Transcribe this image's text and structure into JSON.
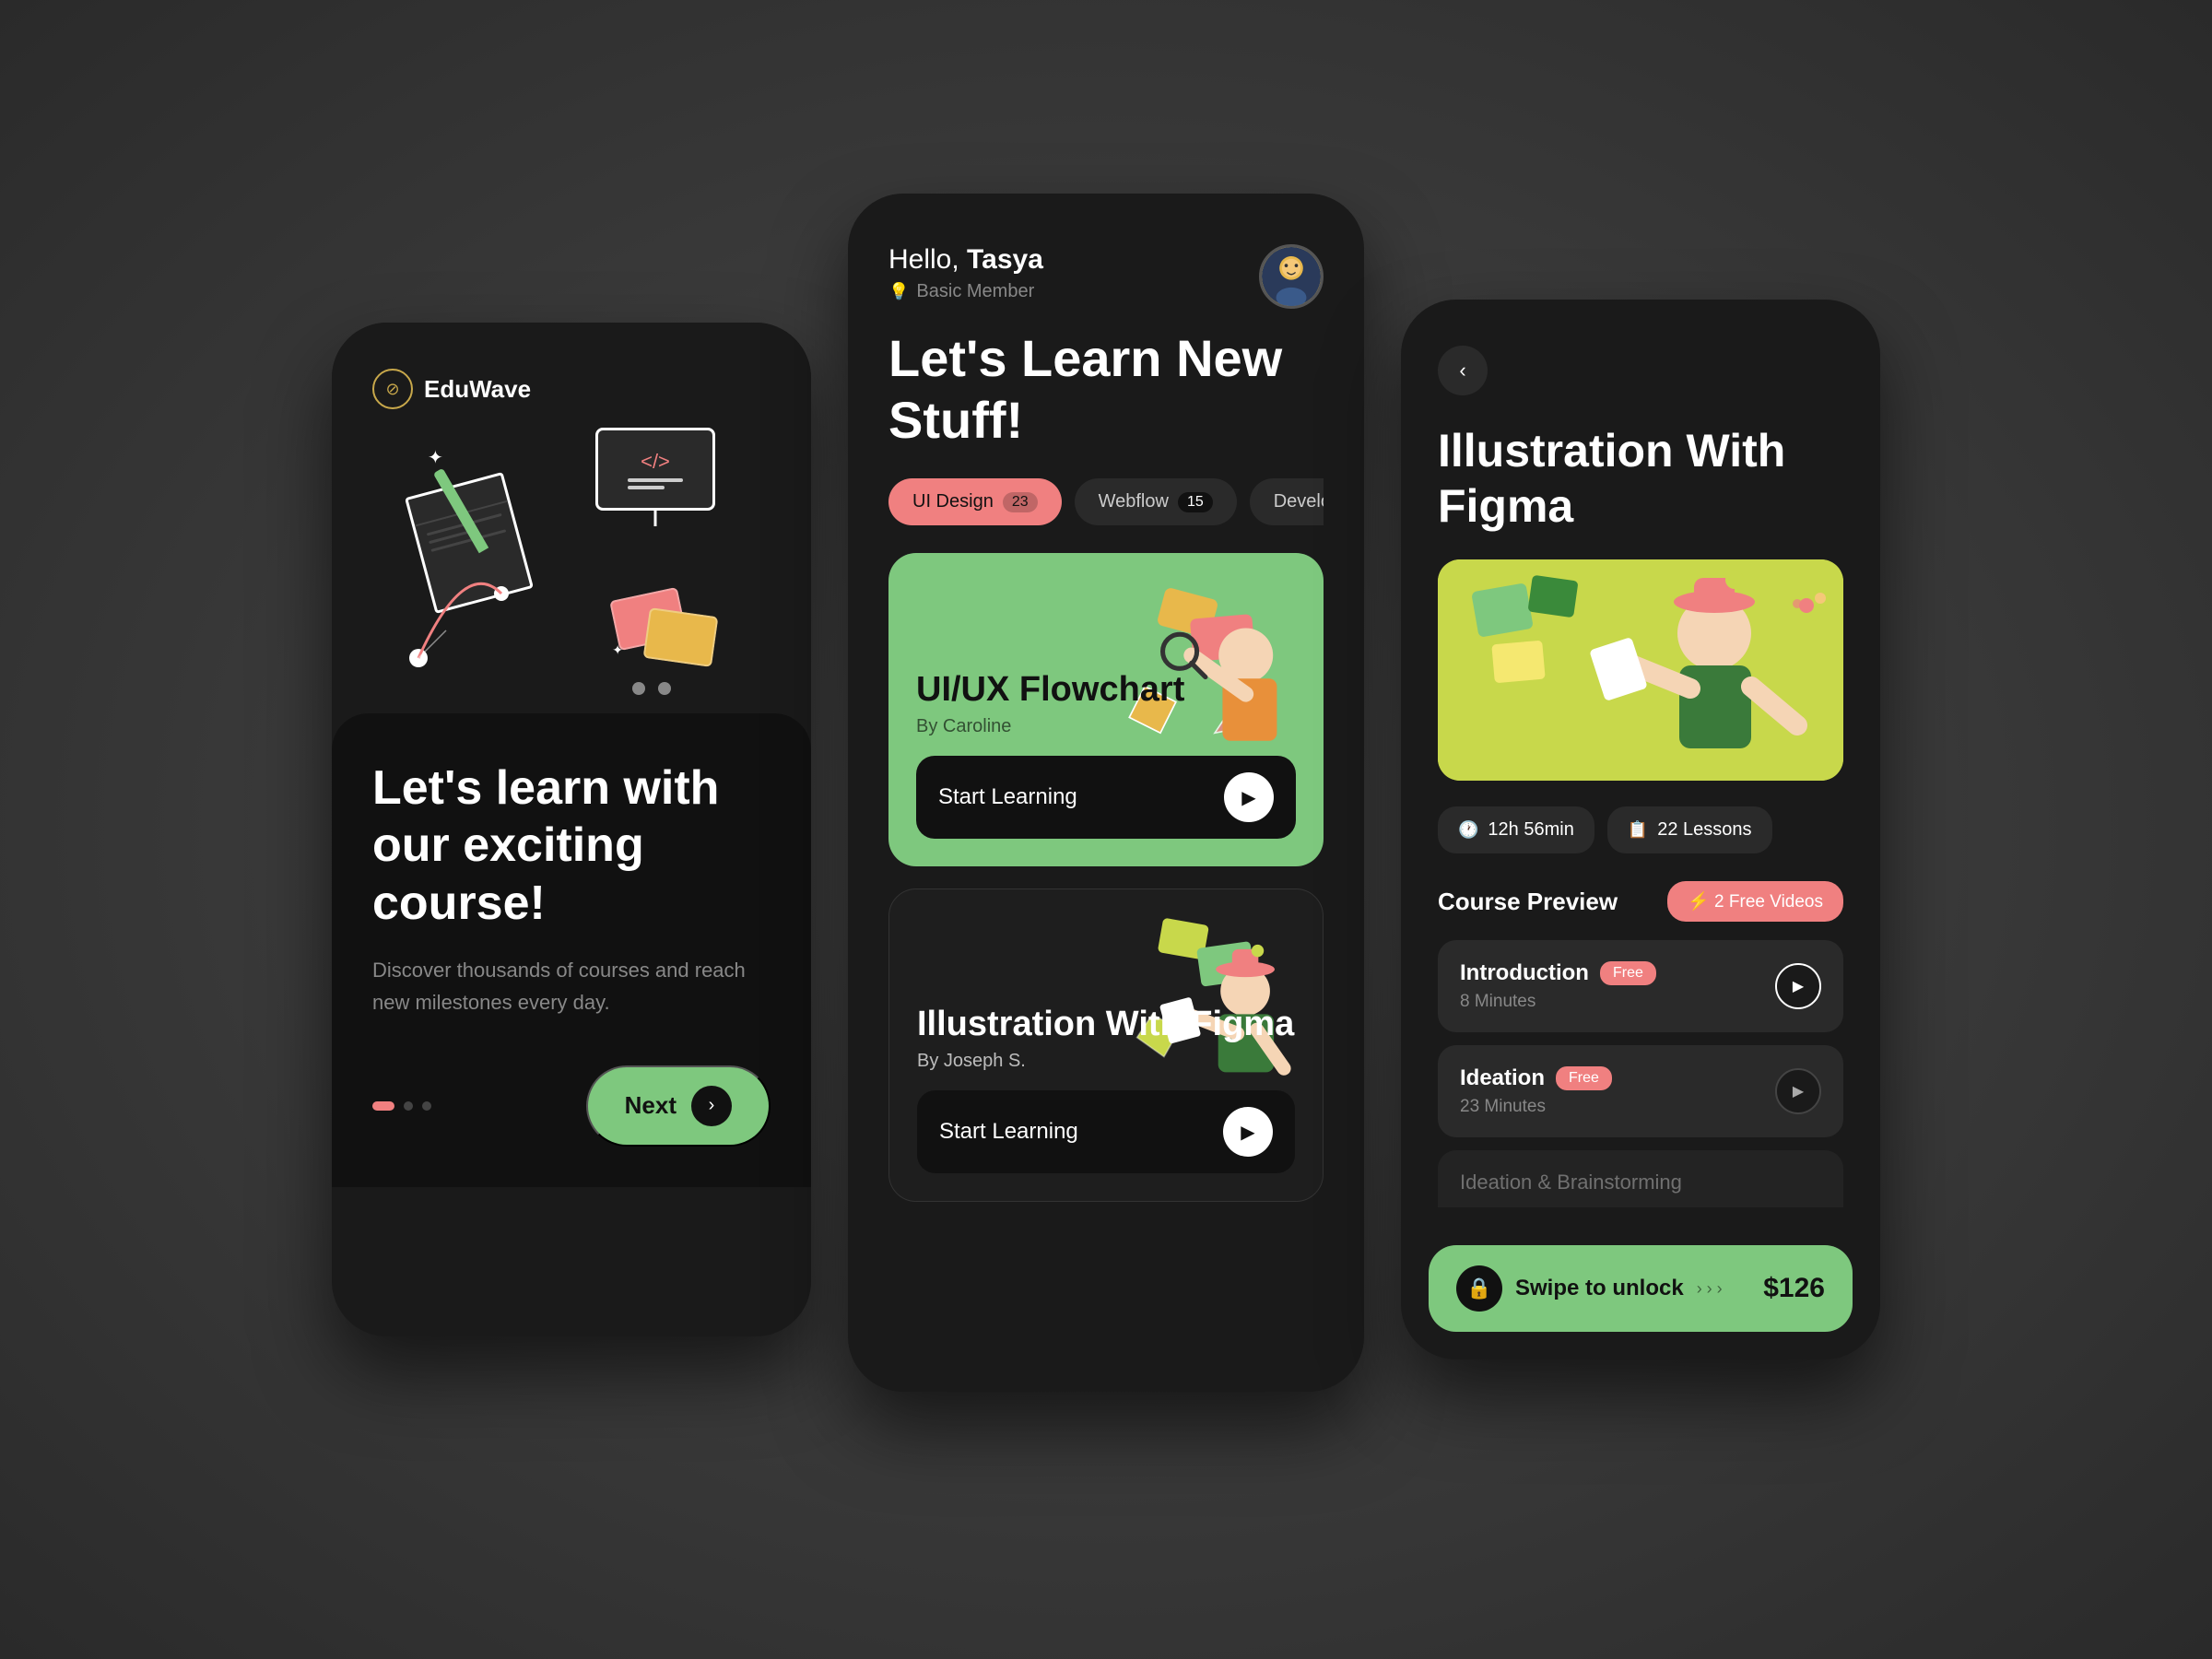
{
  "phone1": {
    "logo": {
      "icon": "⊘",
      "name": "EduWave"
    },
    "headline": "Let's learn with our exciting course!",
    "subtext": "Discover thousands of courses and reach new milestones every day.",
    "next_button": "Next",
    "dots": [
      "active",
      "inactive",
      "inactive"
    ]
  },
  "phone2": {
    "header": {
      "greeting": "Hello, ",
      "name": "Tasya",
      "member_level": "Basic Member"
    },
    "headline": "Let's Learn New Stuff!",
    "categories": [
      {
        "label": "UI Design",
        "count": "23",
        "active": true
      },
      {
        "label": "Webflow",
        "count": "15",
        "active": false
      },
      {
        "label": "Development",
        "count": "",
        "active": false
      }
    ],
    "courses": [
      {
        "title": "UI/UX Flowchart",
        "author": "By Caroline",
        "cta": "Start Learning",
        "theme": "green"
      },
      {
        "title": "Illustration With Figma",
        "author": "By Joseph S.",
        "cta": "Start Learning",
        "theme": "dark"
      }
    ]
  },
  "phone3": {
    "back_icon": "‹",
    "course_title": "Illustration With Figma",
    "meta": [
      {
        "icon": "🕐",
        "value": "12h 56min"
      },
      {
        "icon": "📋",
        "value": "22 Lessons"
      }
    ],
    "preview_section": "Course Preview",
    "free_videos_badge": "⚡ 2 Free Videos",
    "lessons": [
      {
        "title": "Introduction",
        "free": true,
        "duration": "8 Minutes",
        "active": true
      },
      {
        "title": "Ideation",
        "free": true,
        "duration": "23 Minutes",
        "active": false
      },
      {
        "title": "Ideation & Brainstorming",
        "free": false,
        "duration": "",
        "partial": true
      }
    ],
    "unlock": {
      "text": "Swipe to unlock",
      "arrows": "› › ›",
      "price": "$126"
    }
  }
}
